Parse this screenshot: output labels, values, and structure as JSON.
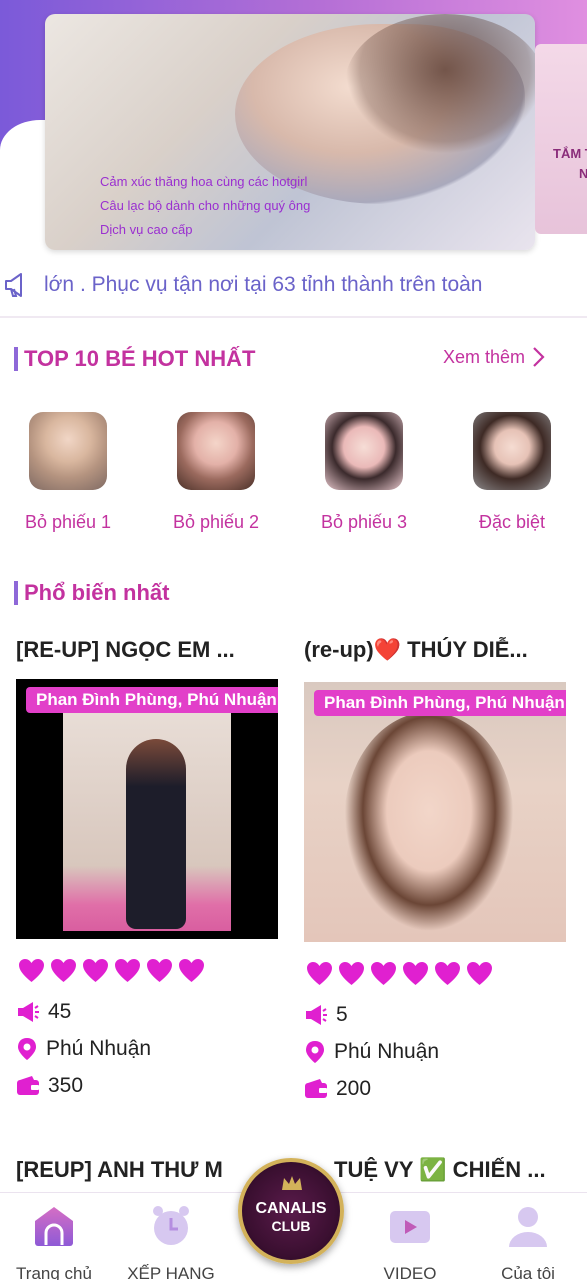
{
  "banner": {
    "lines": [
      "Cảm xúc thăng hoa cùng các hotgirl",
      "Câu lạc bộ dành cho những quý ông",
      "Dịch vụ cao cấp"
    ],
    "side_text_1": "TẮM T",
    "side_text_2": "N"
  },
  "marquee": {
    "text": "lớn . Phục vụ tận nơi tại 63 tỉnh thành trên toàn"
  },
  "top10": {
    "title": "TOP 10 BÉ HOT NHẤT",
    "see_more": "Xem thêm",
    "items": [
      {
        "label": "Bỏ phiếu 1"
      },
      {
        "label": "Bỏ phiếu 2"
      },
      {
        "label": "Bỏ phiếu 3"
      },
      {
        "label": "Đặc biệt"
      }
    ]
  },
  "popular": {
    "title": "Phổ biến nhất",
    "cards": [
      {
        "title": "[RE-UP] NGỌC EM ...",
        "location_badge": "Phan Đình Phùng, Phú Nhuận",
        "hearts": 6,
        "views": "45",
        "district": "Phú Nhuận",
        "price": "350"
      },
      {
        "title": "(re-up)❤️ THÚY DIỄ...",
        "location_badge": "Phan Đình Phùng, Phú Nhuận",
        "hearts": 6,
        "views": "5",
        "district": "Phú Nhuận",
        "price": "200"
      }
    ],
    "next_titles": [
      "[REUP] ANH THƯ M",
      "TUỆ VY ✅ CHIẾN ..."
    ]
  },
  "nav": {
    "items": [
      "Trang chủ",
      "XẾP HẠNG",
      "VIDEO",
      "Của tôi"
    ],
    "logo_line1": "CANALIS",
    "logo_line2": "CLUB"
  },
  "colors": {
    "accent": "#c3329f",
    "badge": "#e23fc9",
    "heart": "#e020d0"
  }
}
